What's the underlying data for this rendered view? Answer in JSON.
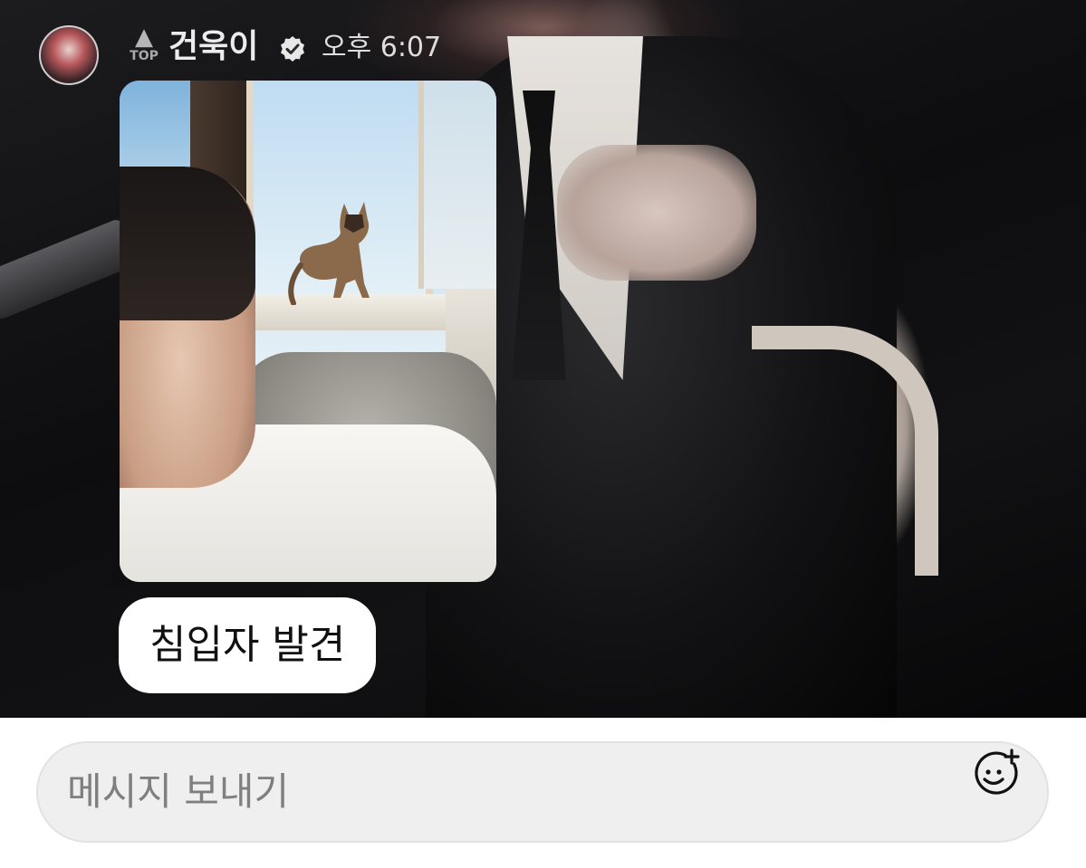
{
  "header": {
    "rank_label": "TOP",
    "sender_name": "건욱이",
    "time": "오후 6:07"
  },
  "message": {
    "caption": "침입자 발견"
  },
  "composer": {
    "placeholder": "메시지 보내기"
  },
  "icons": {
    "rank": "up-arrow-icon",
    "verified": "verified-check-icon",
    "sticker": "smiley-plus-icon"
  },
  "colors": {
    "composer_background": "#efefef",
    "bubble_background": "#ffffff",
    "name_text": "#ececec"
  }
}
